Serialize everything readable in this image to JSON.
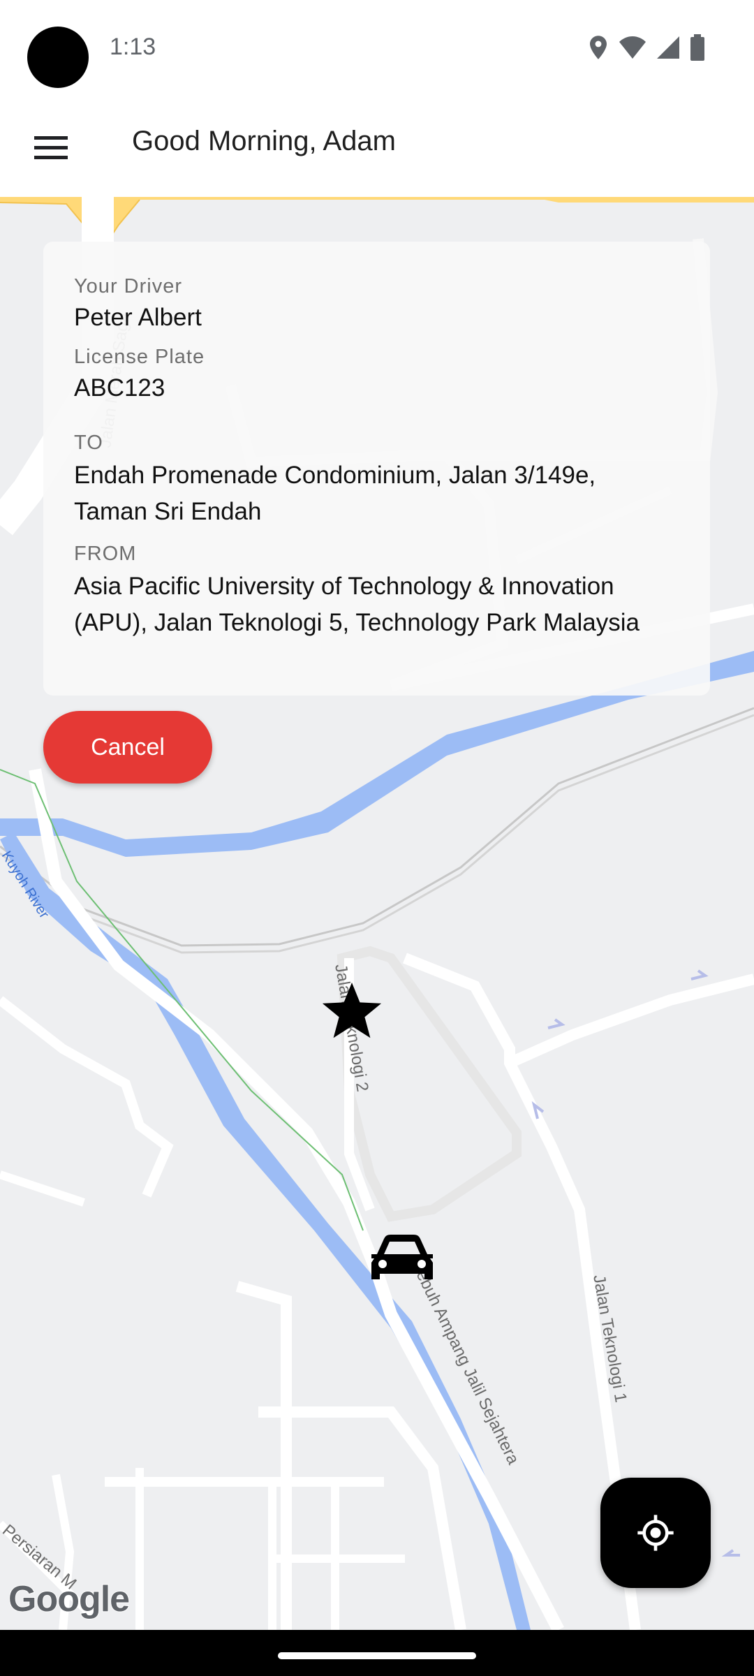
{
  "status_bar": {
    "time": "1:13"
  },
  "app_bar": {
    "title": "Good Morning, Adam"
  },
  "trip_card": {
    "driver_label": "Your Driver",
    "driver_name": "Peter Albert",
    "plate_label": "License Plate",
    "plate_value": "ABC123",
    "to_label": "TO",
    "to_line1": "Endah Promenade Condominium, Jalan 3/149e,",
    "to_line2": "Taman Sri Endah",
    "from_label": "FROM",
    "from_line1": "Asia Pacific University of Technology & Innovation",
    "from_line2": "(APU), Jalan Teknologi 5, Technology Park Malaysia"
  },
  "cancel_label": "Cancel",
  "map": {
    "labels": {
      "road_top": "Jalan Merah Saga",
      "river": "Kuyoh River",
      "teknologi2": "Jalan Teknologi 2",
      "jalil": "Lebuh Ampang Jalil Sejahtera",
      "teknologi1": "Jalan Teknologi 1",
      "persiaran": "Persiaran M"
    },
    "attribution": "Google",
    "colors": {
      "water": "#9cbcf5",
      "road": "#ffffff",
      "highway": "#ffd978",
      "land": "#eeeff1"
    }
  },
  "icons": {
    "menu": "menu-icon",
    "locate": "my-location-icon",
    "destination": "star-icon",
    "driver": "car-icon"
  }
}
